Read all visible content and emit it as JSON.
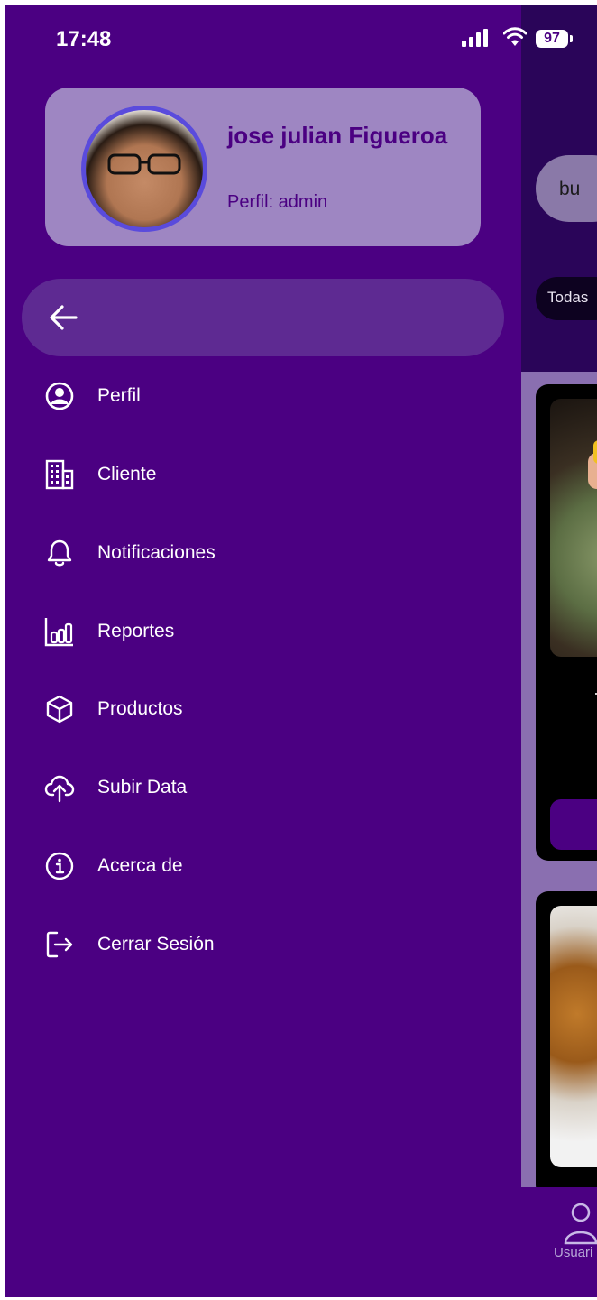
{
  "status_bar": {
    "time": "17:48",
    "battery": "97"
  },
  "profile": {
    "name": "jose julian Figueroa",
    "role": "Perfil: admin"
  },
  "menu": {
    "items": [
      {
        "label": "Perfil",
        "icon": "user-circle-icon"
      },
      {
        "label": "Cliente",
        "icon": "building-icon"
      },
      {
        "label": "Notificaciones",
        "icon": "bell-icon"
      },
      {
        "label": "Reportes",
        "icon": "bar-chart-icon"
      },
      {
        "label": "Productos",
        "icon": "cube-icon"
      },
      {
        "label": "Subir Data",
        "icon": "cloud-upload-icon"
      },
      {
        "label": "Acerca de",
        "icon": "info-icon"
      },
      {
        "label": "Cerrar Sesión",
        "icon": "logout-icon"
      }
    ]
  },
  "background_screen": {
    "search_text": "bu",
    "filter_chip": "Todas",
    "bottom_nav_label": "Usuari"
  },
  "colors": {
    "primary": "#4b0082",
    "profile_card": "#9e86c2",
    "back_bar": "#5e2a92",
    "text_on_primary": "#ffffff"
  }
}
